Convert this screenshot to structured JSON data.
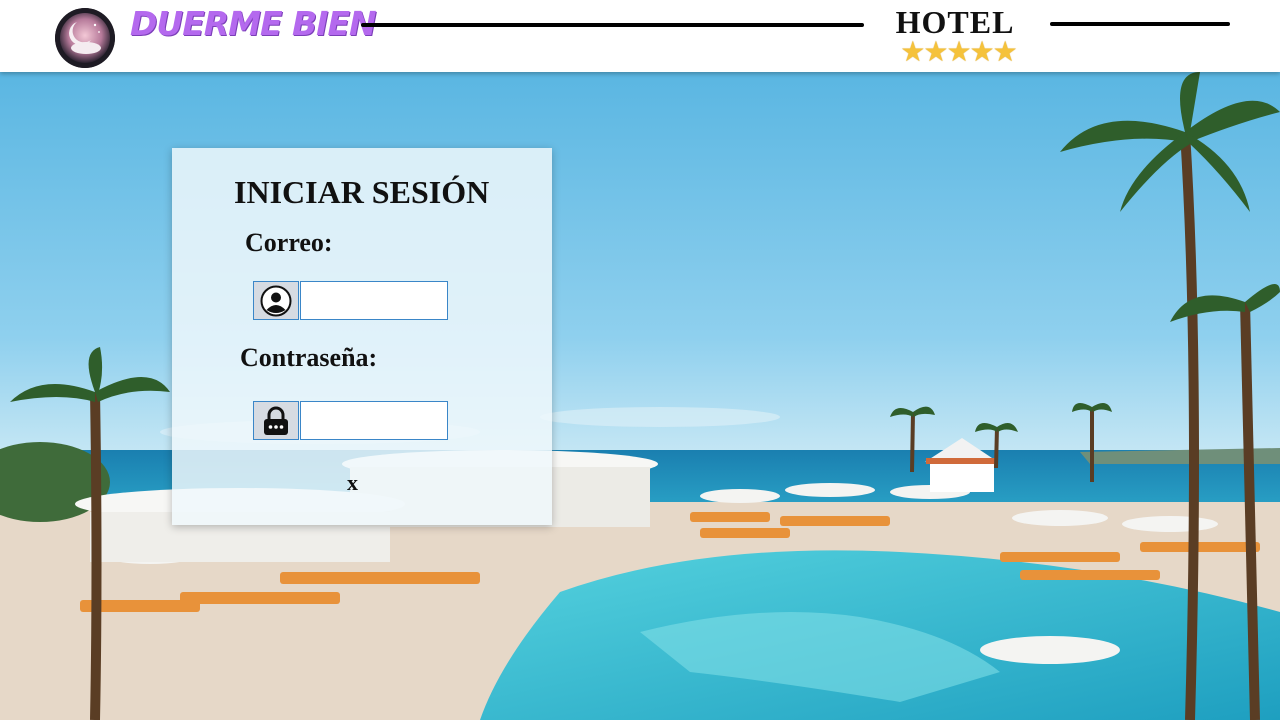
{
  "header": {
    "brand_name": "DUERME BIEN",
    "hotel_label": "HOTEL",
    "star_rating": 5,
    "stars_text": "★★★★★",
    "logo_icon": "moon-pillow-logo-icon"
  },
  "login": {
    "title": "INICIAR SESIÓN",
    "email_label": "Correo:",
    "email_value": "",
    "email_icon": "user-circle-icon",
    "password_label": "Contraseña:",
    "password_value": "",
    "password_icon": "lock-icon",
    "close_label": "x"
  },
  "background": {
    "description_icon": "resort-pool-photo",
    "colors": {
      "sky": "#6ec3e6",
      "sea": "#1f8fb8",
      "pool": "#3cc3d6",
      "loungers": "#e8923a",
      "deck": "#e9ddd0"
    }
  },
  "colors": {
    "brand": "#b469ee",
    "stars": "#f5c23b",
    "field_border": "#3a86c8"
  }
}
